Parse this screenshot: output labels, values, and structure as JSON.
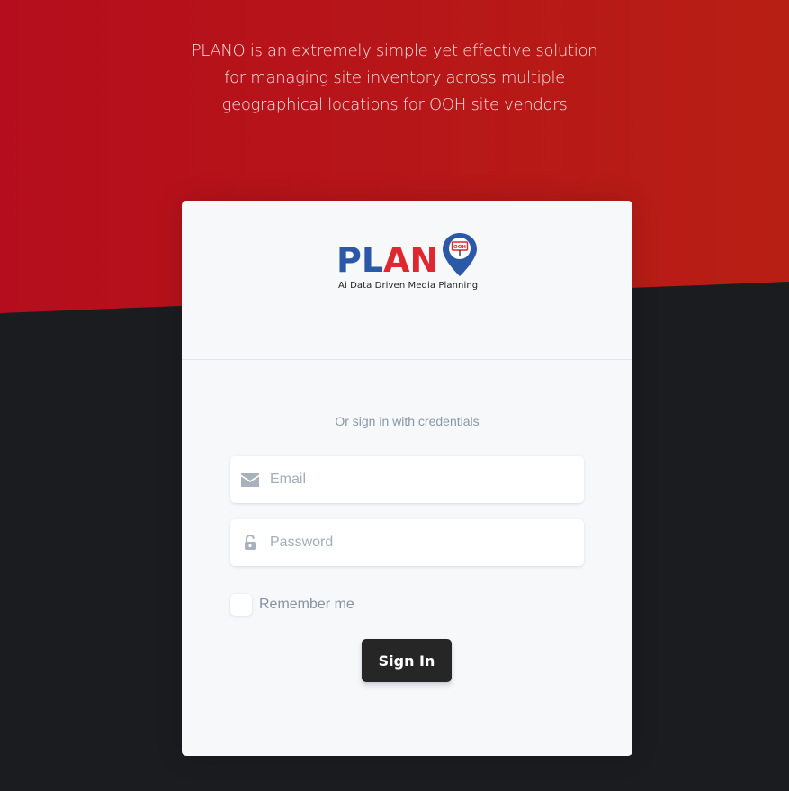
{
  "hero": {
    "tagline": "PLANO is an extremely simple yet effective solution for managing site inventory across multiple geographical locations for OOH site vendors"
  },
  "logo": {
    "word_blue": "PL",
    "word_red": "AN",
    "pin_text": "OOH",
    "tagline": "Ai Data Driven Media Planning"
  },
  "login": {
    "subtitle": "Or sign in with credentials",
    "email_placeholder": "Email",
    "password_placeholder": "Password",
    "remember_label": "Remember me",
    "signin_label": "Sign In"
  },
  "colors": {
    "hero_red": "#b50d1d",
    "hero_red_right": "#b81f14",
    "dark_bg": "#1b1c1f",
    "card_bg": "#f6f8fa",
    "logo_blue": "#2b59a7",
    "logo_red": "#e0262e",
    "button_bg": "#262626"
  },
  "icons": {
    "email": "envelope-icon",
    "password": "lock-open-icon",
    "pin": "map-pin-icon"
  }
}
